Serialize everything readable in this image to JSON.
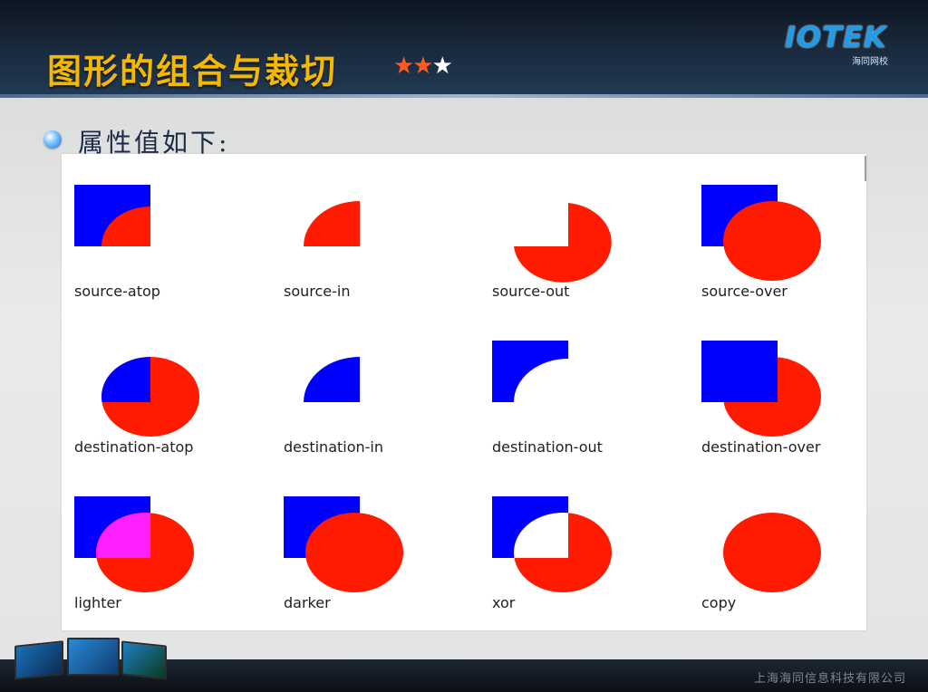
{
  "slide": {
    "title": "图形的组合与裁切",
    "stars_filled": "★★",
    "stars_empty": "★",
    "subtitle": "属性值如下:",
    "logo": "IOTEK",
    "logo_sub": "海同网校",
    "footer_company": "上海海同信息科技有限公司"
  },
  "colors": {
    "title": "#f5b800",
    "source_red": "#ff1a00",
    "destination_blue": "#0000ff",
    "lighter_magenta": "#ff20ff"
  },
  "composite_modes": [
    {
      "name": "source-atop"
    },
    {
      "name": "source-in"
    },
    {
      "name": "source-out"
    },
    {
      "name": "source-over"
    },
    {
      "name": "destination-atop"
    },
    {
      "name": "destination-in"
    },
    {
      "name": "destination-out"
    },
    {
      "name": "destination-over"
    },
    {
      "name": "lighter"
    },
    {
      "name": "darker"
    },
    {
      "name": "xor"
    },
    {
      "name": "copy"
    }
  ]
}
